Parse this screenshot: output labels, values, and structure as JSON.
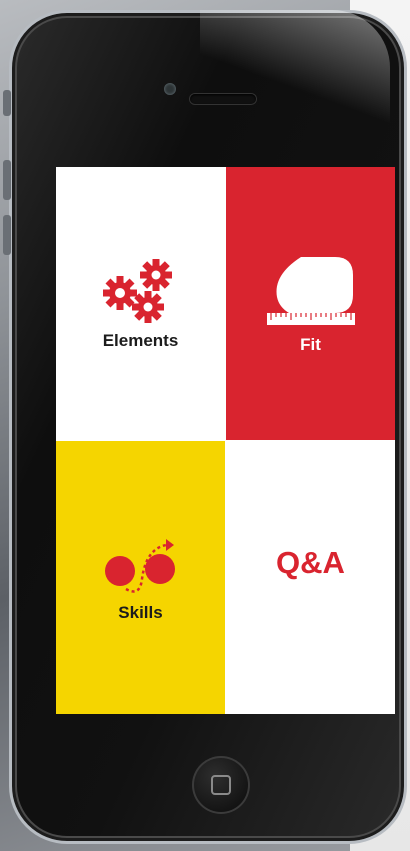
{
  "tiles": [
    {
      "id": "elements",
      "label": "Elements",
      "icon": "gears-icon",
      "color": "#ffffff"
    },
    {
      "id": "fit",
      "label": "Fit",
      "icon": "measuring-tape-icon",
      "color": "#d9242f"
    },
    {
      "id": "skills",
      "label": "Skills",
      "icon": "skills-motion-icon",
      "color": "#f5d500"
    },
    {
      "id": "qa",
      "label": "Q&A",
      "icon": "qa-text",
      "color": "#ffffff"
    }
  ],
  "colors": {
    "accent_red": "#d9242f",
    "accent_yellow": "#f5d500",
    "badge_outline": "#d86a1e"
  }
}
